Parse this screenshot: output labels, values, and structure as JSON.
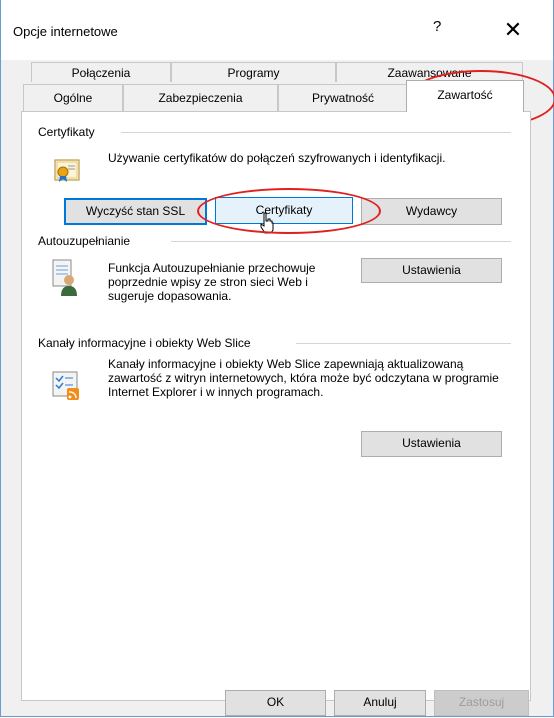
{
  "window": {
    "title": "Opcje internetowe",
    "help": "?",
    "close": "✕"
  },
  "tabs": {
    "back": [
      "Połączenia",
      "Programy",
      "Zaawansowane"
    ],
    "front": [
      "Ogólne",
      "Zabezpieczenia",
      "Prywatność",
      "Zawartość"
    ]
  },
  "certificates": {
    "label": "Certyfikaty",
    "description": "Używanie certyfikatów do połączeń szyfrowanych i identyfikacji.",
    "buttons": [
      "Wyczyść stan SSL",
      "Certyfikaty",
      "Wydawcy"
    ]
  },
  "autocomplete": {
    "label": "Autouzupełnianie",
    "description": "Funkcja Autouzupełnianie przechowuje poprzednie wpisy ze stron sieci Web i sugeruje dopasowania.",
    "settings": "Ustawienia"
  },
  "feeds": {
    "label": "Kanały informacyjne i obiekty Web Slice",
    "description": "Kanały informacyjne i obiekty Web Slice zapewniają aktualizowaną zawartość z witryn internetowych, która może być odczytana w programie Internet Explorer i w innych programach.",
    "settings": "Ustawienia"
  },
  "footer": {
    "ok": "OK",
    "cancel": "Anuluj",
    "apply": "Zastosuj"
  },
  "colors": {
    "accent": "#0078d7",
    "annotation": "#e0201e"
  }
}
